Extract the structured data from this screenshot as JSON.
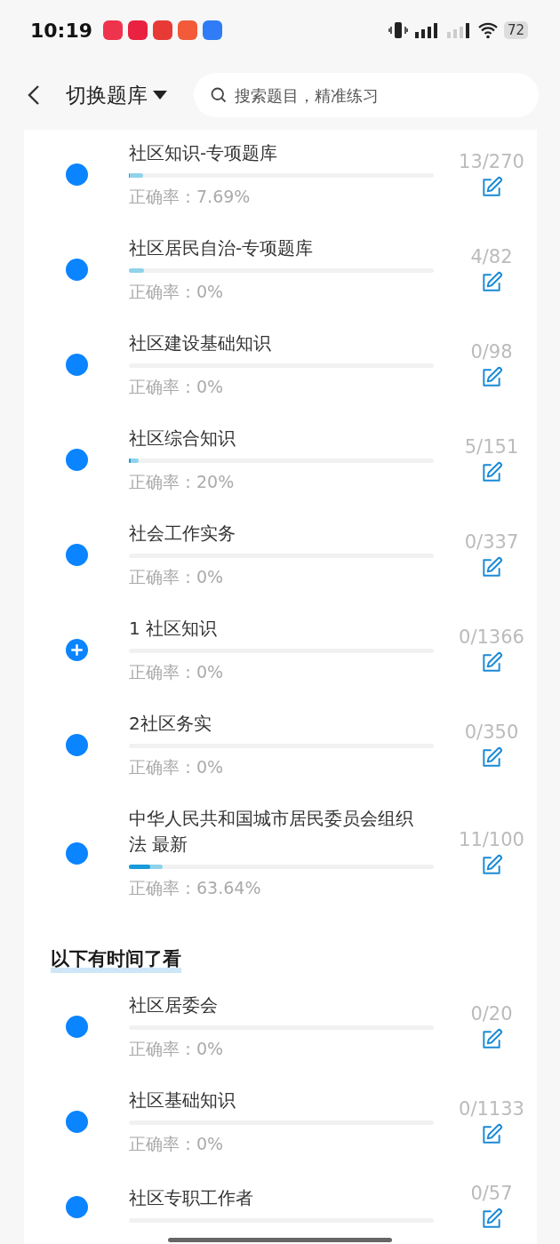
{
  "status_bar": {
    "time": "10:19",
    "battery": "72"
  },
  "header": {
    "title": "切换题库",
    "search": {
      "placeholder": "搜索题目，精准练习"
    }
  },
  "sections": [
    {
      "items": [
        {
          "kind": "leaf",
          "title": "社区知识-专项题库",
          "count": "13/270",
          "accuracy": "正确率：7.69%",
          "progress": {
            "level": 0.048
          },
          "correct": {
            "level": 0.0037
          }
        },
        {
          "kind": "leaf",
          "title": "社区居民自治-专项题库",
          "count": "4/82",
          "accuracy": "正确率：0%",
          "progress": {
            "level": 0.049
          }
        },
        {
          "kind": "leaf",
          "title": "社区建设基础知识",
          "count": "0/98",
          "accuracy": "正确率：0%"
        },
        {
          "kind": "leaf",
          "title": "社区综合知识",
          "count": "5/151",
          "accuracy": "正确率：20%",
          "progress": {
            "level": 0.033
          },
          "correct": {
            "level": 0.0066
          }
        },
        {
          "kind": "leaf",
          "title": "社会工作实务",
          "count": "0/337",
          "accuracy": "正确率：0%"
        },
        {
          "kind": "group",
          "title": "1 社区知识",
          "count": "0/1366",
          "accuracy": "正确率：0%"
        },
        {
          "kind": "leaf",
          "title": "2社区务实",
          "count": "0/350",
          "accuracy": "正确率：0%"
        },
        {
          "kind": "leaf",
          "title": "中华人民共和国城市居民委员会组织法 最新",
          "count": "11/100",
          "accuracy": "正确率：63.64%",
          "progress": {
            "level": 0.11
          },
          "correct": {
            "level": 0.07
          }
        }
      ]
    },
    {
      "heading": "以下有时间了看",
      "items": [
        {
          "kind": "leaf",
          "title": "社区居委会",
          "count": "0/20",
          "accuracy": "正确率：0%"
        },
        {
          "kind": "leaf",
          "title": "社区基础知识",
          "count": "0/1133",
          "accuracy": "正确率：0%"
        },
        {
          "kind": "leaf",
          "title": "社区专职工作者",
          "count": "0/57"
        }
      ]
    }
  ]
}
